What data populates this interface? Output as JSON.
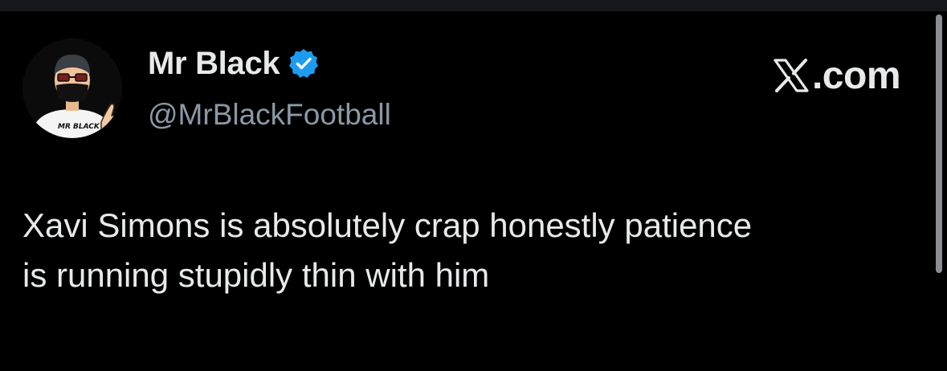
{
  "tweet": {
    "display_name": "Mr Black",
    "handle": "@MrBlackFootball",
    "text": "Xavi Simons is absolutely crap honestly patience\nis running stupidly thin with him",
    "verified": true,
    "avatar_label": "MR BLACK"
  },
  "branding": {
    "site": ".com",
    "logo_icon": "x-logo-icon"
  },
  "colors": {
    "background": "#000000",
    "text_primary": "#e7e9ea",
    "text_secondary": "#8b98a5",
    "verified_blue": "#1d9bf0",
    "scrollbar": "#8a8d91"
  }
}
